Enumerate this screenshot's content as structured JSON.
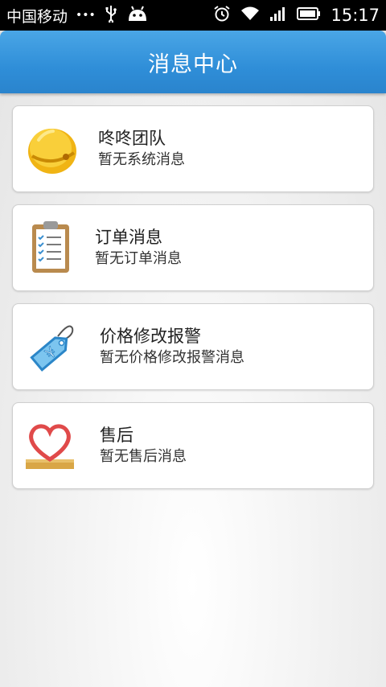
{
  "status_bar": {
    "carrier": "中国移动",
    "dots": "•••",
    "time": "15:17"
  },
  "header": {
    "title": "消息中心"
  },
  "messages": [
    {
      "name": "咚咚团队",
      "status": "暂无系统消息",
      "icon": "bell-icon"
    },
    {
      "name": "订单消息",
      "status": "暂无订单消息",
      "icon": "clipboard-icon"
    },
    {
      "name": "价格修改报警",
      "status": "暂无价格修改报警消息",
      "icon": "price-tag-icon"
    },
    {
      "name": "售后",
      "status": "暂无售后消息",
      "icon": "heart-icon"
    }
  ],
  "colors": {
    "header_blue": "#2f8ed8",
    "bell_yellow": "#f7c21c"
  }
}
